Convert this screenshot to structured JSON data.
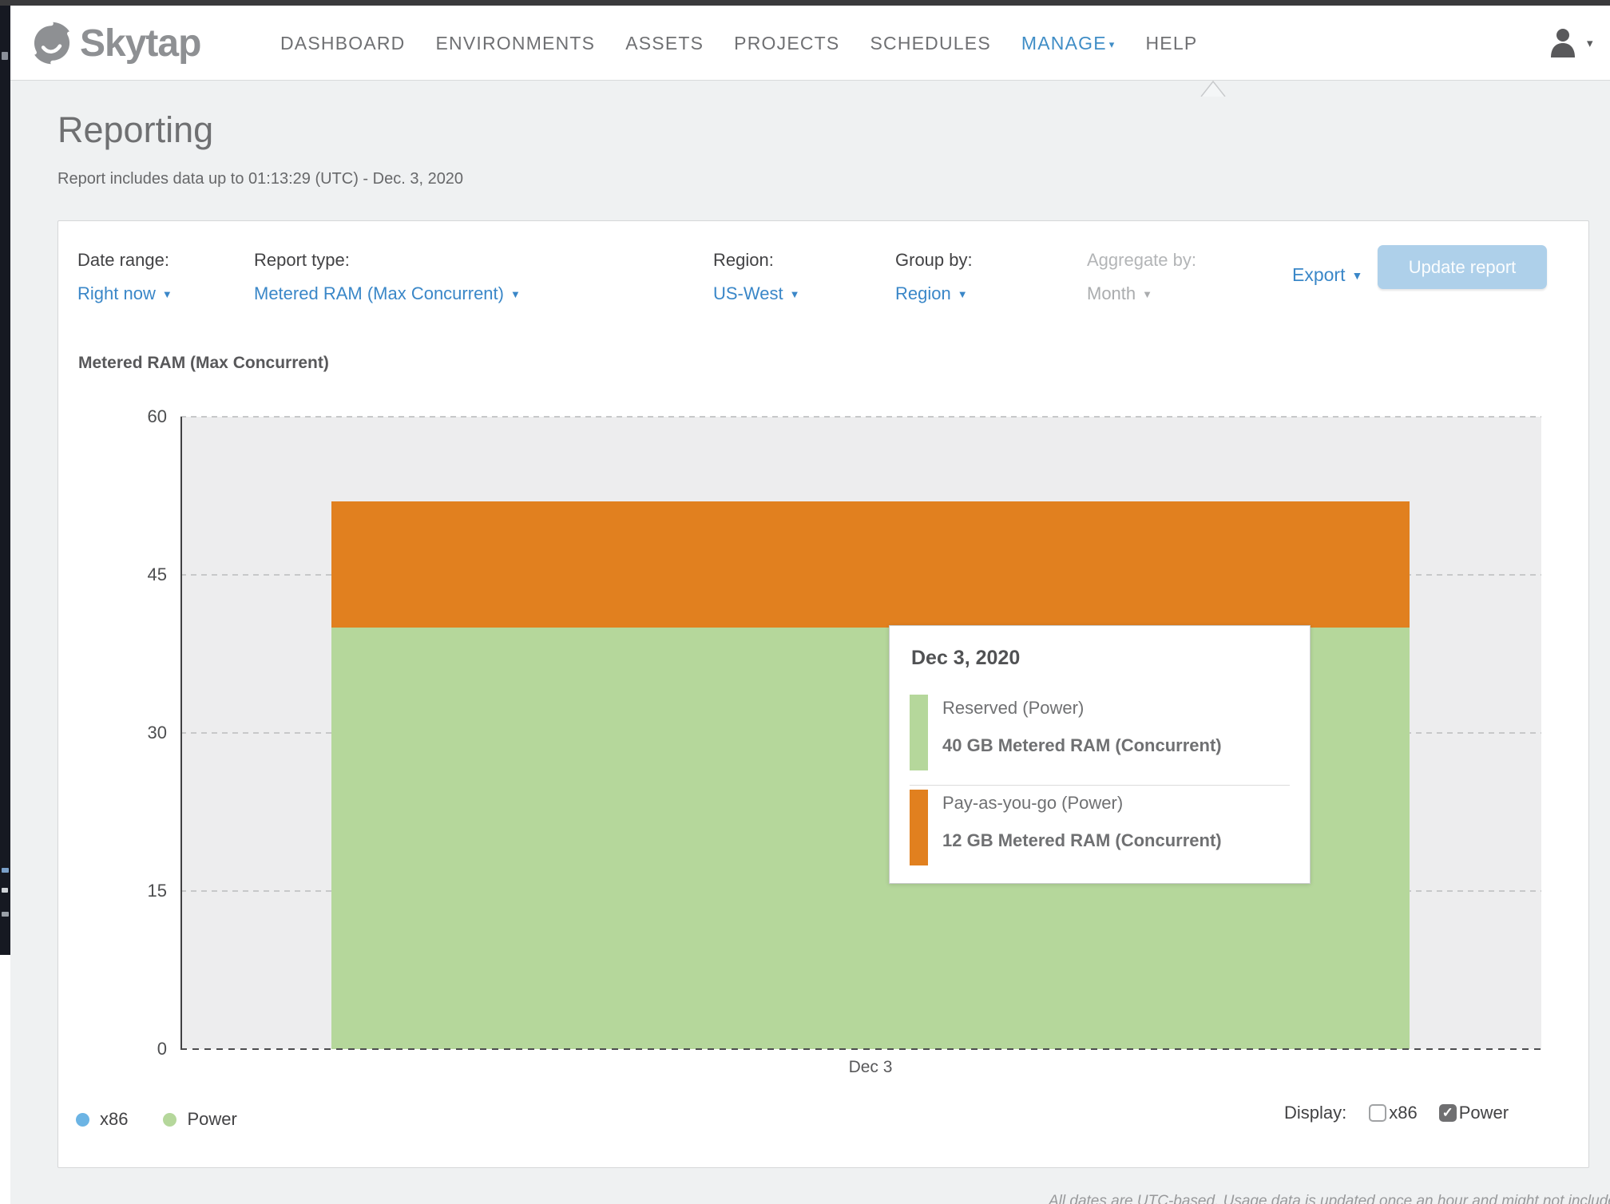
{
  "icons": {
    "caret_down": "▼",
    "caret_down_small": "▾",
    "check": "✓"
  },
  "nav": {
    "brand": "Skytap",
    "items": [
      {
        "label": "DASHBOARD",
        "active": false
      },
      {
        "label": "ENVIRONMENTS",
        "active": false
      },
      {
        "label": "ASSETS",
        "active": false
      },
      {
        "label": "PROJECTS",
        "active": false
      },
      {
        "label": "SCHEDULES",
        "active": false
      },
      {
        "label": "MANAGE",
        "active": true
      },
      {
        "label": "HELP",
        "active": false
      }
    ]
  },
  "page": {
    "title": "Reporting",
    "subtitle": "Report includes data up to 01:13:29 (UTC) - Dec. 3, 2020",
    "footnote": "All dates are UTC-based. Usage data is updated once an hour and might not include the most recent UTC hour."
  },
  "filters": [
    {
      "label": "Date range:",
      "value": "Right now",
      "disabled": false
    },
    {
      "label": "Report type:",
      "value": "Metered RAM (Max Concurrent)",
      "disabled": false
    },
    {
      "label": "Region:",
      "value": "US-West",
      "disabled": false
    },
    {
      "label": "Group by:",
      "value": "Region",
      "disabled": false
    },
    {
      "label": "Aggregate by:",
      "value": "Month",
      "disabled": true
    }
  ],
  "actions": {
    "export_label": "Export",
    "update_report_label": "Update report"
  },
  "chart_data": {
    "type": "bar",
    "stacked": true,
    "title": "Metered RAM (Max Concurrent)",
    "categories": [
      "Dec 3"
    ],
    "series": [
      {
        "name": "Reserved (Power)",
        "color": "#b5d79b",
        "values": [
          40
        ]
      },
      {
        "name": "Pay-as-you-go (Power)",
        "color": "#e1801f",
        "values": [
          12
        ]
      }
    ],
    "ylim": [
      0,
      60
    ],
    "yticks": [
      0,
      15,
      30,
      45,
      60
    ],
    "xlabel": "",
    "ylabel": "",
    "unit": "GB Metered RAM (Concurrent)",
    "grid": "dashed horizontal",
    "legend_position": "bottom-left",
    "legend": [
      {
        "label": "x86",
        "color": "#6cb4e4"
      },
      {
        "label": "Power",
        "color": "#b5d79b"
      }
    ]
  },
  "tooltip": {
    "heading": "Dec 3, 2020",
    "rows": [
      {
        "name": "Reserved (Power)",
        "value": "40 GB Metered RAM (Concurrent)",
        "color": "#b5d79b"
      },
      {
        "name": "Pay-as-you-go (Power)",
        "value": "12 GB Metered RAM (Concurrent)",
        "color": "#e1801f"
      }
    ]
  },
  "display": {
    "label": "Display:",
    "options": [
      {
        "label": "x86",
        "checked": false
      },
      {
        "label": "Power",
        "checked": true
      }
    ]
  },
  "theme": {
    "link_blue": "#3a87c8",
    "nav_active_blue": "#3f8dc6",
    "button_bg": "#aed0ea",
    "plot_bg": "#ededee"
  }
}
